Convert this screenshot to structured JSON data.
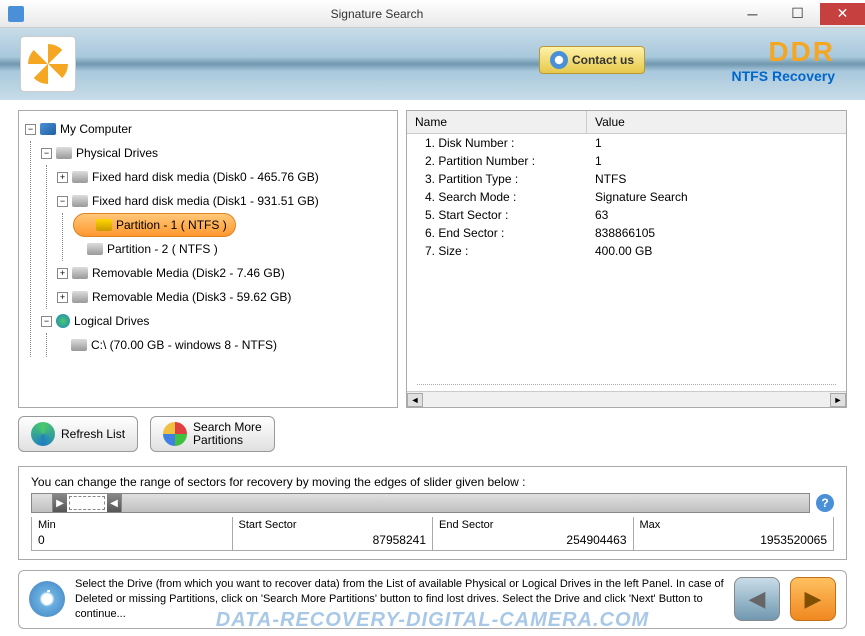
{
  "window": {
    "title": "Signature Search"
  },
  "header": {
    "contact_label": "Contact us",
    "brand": "DDR",
    "product": "NTFS Recovery"
  },
  "tree": {
    "root": "My Computer",
    "physical_label": "Physical Drives",
    "drives": [
      {
        "label": "Fixed hard disk media (Disk0 - 465.76 GB)",
        "expanded": false
      },
      {
        "label": "Fixed hard disk media (Disk1 - 931.51 GB)",
        "expanded": true,
        "partitions": [
          {
            "label": "Partition - 1 ( NTFS )",
            "selected": true
          },
          {
            "label": "Partition - 2 ( NTFS )",
            "selected": false
          }
        ]
      },
      {
        "label": "Removable Media (Disk2 - 7.46 GB)",
        "expanded": false
      },
      {
        "label": "Removable Media (Disk3 - 59.62 GB)",
        "expanded": false
      }
    ],
    "logical_label": "Logical Drives",
    "logical": [
      {
        "label": "C:\\ (70.00 GB - windows 8 - NTFS)"
      }
    ]
  },
  "props": {
    "header_name": "Name",
    "header_value": "Value",
    "rows": [
      {
        "name": "1. Disk Number :",
        "value": "1"
      },
      {
        "name": "2. Partition Number :",
        "value": "1"
      },
      {
        "name": "3. Partition Type :",
        "value": "NTFS"
      },
      {
        "name": "4. Search Mode :",
        "value": "Signature Search"
      },
      {
        "name": "5. Start Sector :",
        "value": "63"
      },
      {
        "name": "6. End Sector :",
        "value": "838866105"
      },
      {
        "name": "7. Size :",
        "value": "400.00 GB"
      }
    ]
  },
  "actions": {
    "refresh": "Refresh List",
    "search_more": "Search More\nPartitions"
  },
  "sector": {
    "hint": "You can change the range of sectors for recovery by moving the edges of slider given below :",
    "min_label": "Min",
    "min_value": "0",
    "start_label": "Start Sector",
    "start_value": "87958241",
    "end_label": "End Sector",
    "end_value": "254904463",
    "max_label": "Max",
    "max_value": "1953520065"
  },
  "footer": {
    "info_text": "Select the Drive (from which you want to recover data) from the List of available Physical or Logical Drives in the left Panel. In case of Deleted or missing Partitions, click on 'Search More Partitions' button to find lost drives. Select the Drive and click 'Next' Button to continue..."
  },
  "watermark": "DATA-RECOVERY-DIGITAL-CAMERA.COM"
}
